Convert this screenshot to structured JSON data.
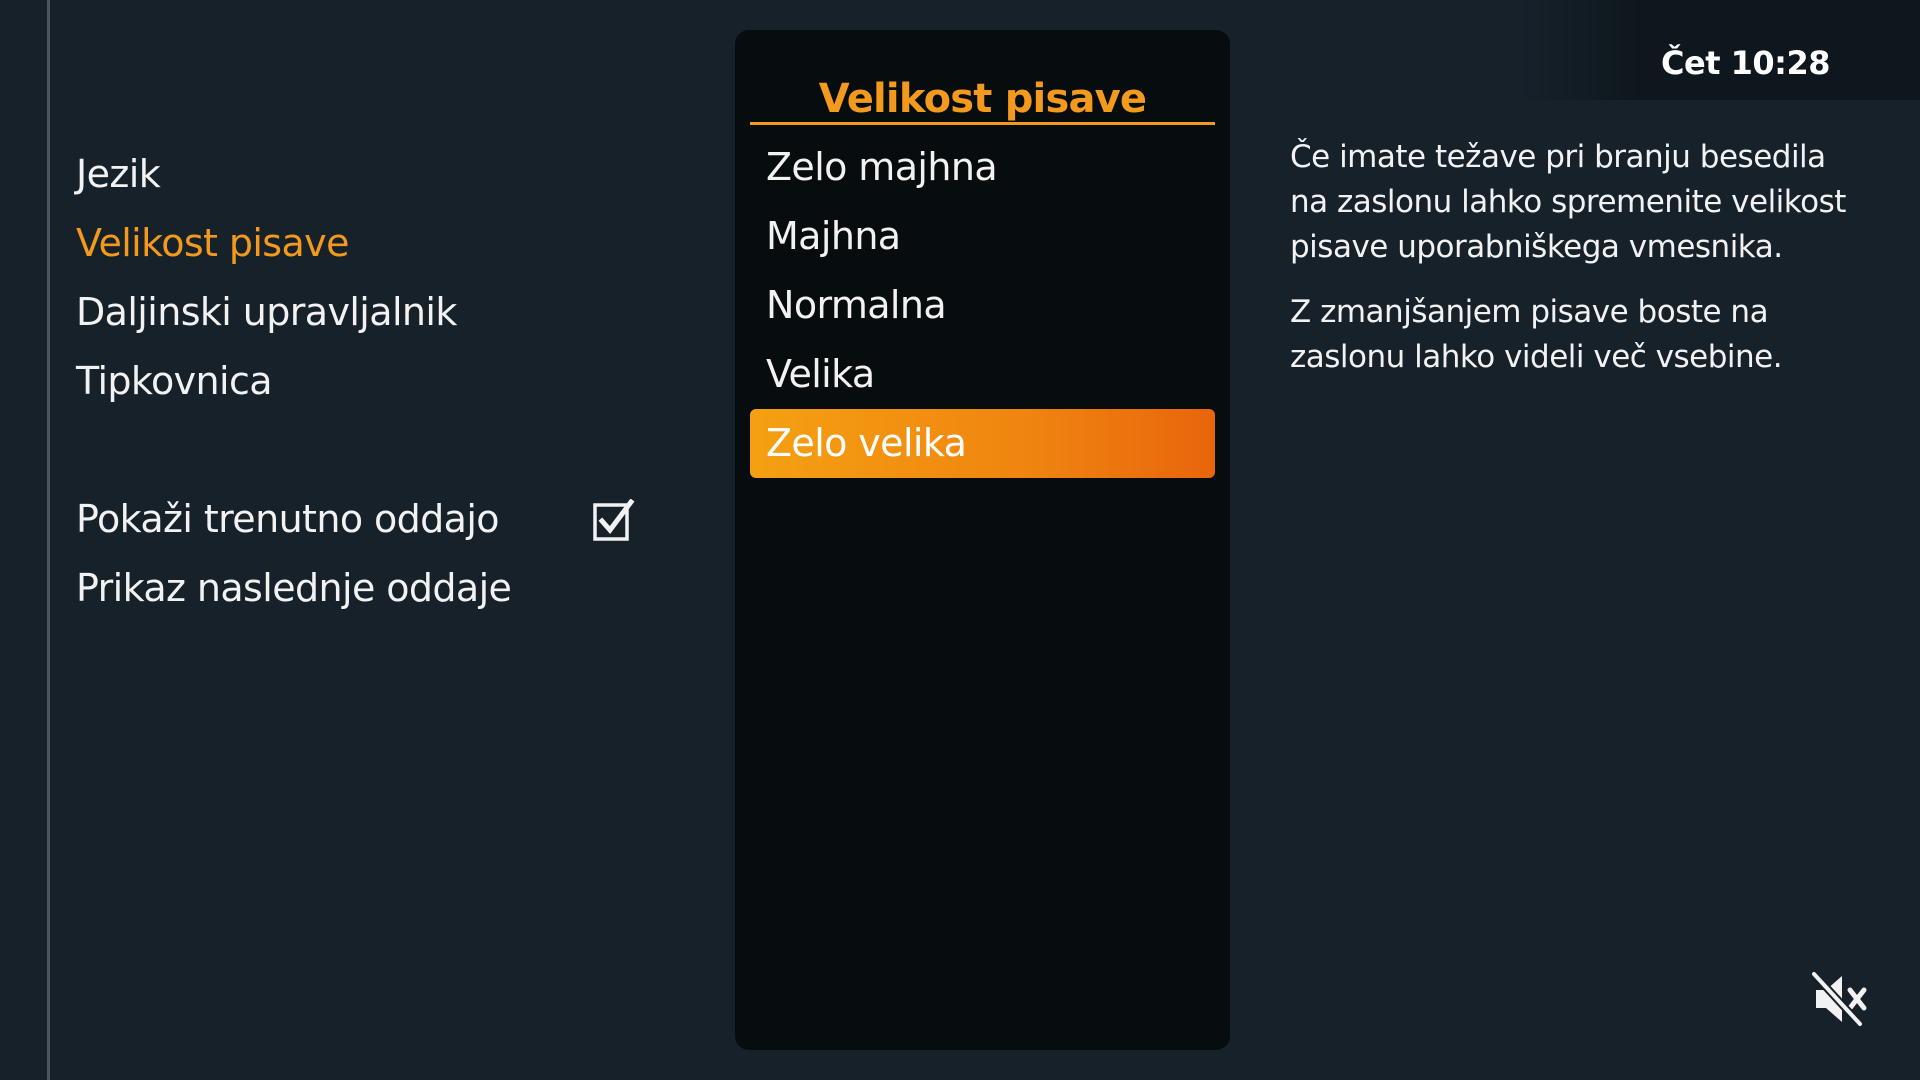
{
  "header": {
    "clock": "Čet 10:28"
  },
  "settings_menu": {
    "items": [
      {
        "label": "Jezik",
        "selected": false
      },
      {
        "label": "Velikost pisave",
        "selected": true
      },
      {
        "label": "Daljinski upravljalnik",
        "selected": false
      },
      {
        "label": "Tipkovnica",
        "selected": false
      }
    ],
    "toggles": [
      {
        "label": "Pokaži trenutno oddajo",
        "checked": true
      },
      {
        "label": "Prikaz naslednje oddaje",
        "checked": false
      }
    ]
  },
  "font_size_panel": {
    "title": "Velikost pisave",
    "options": [
      {
        "label": "Zelo majhna",
        "selected": false
      },
      {
        "label": "Majhna",
        "selected": false
      },
      {
        "label": "Normalna",
        "selected": false
      },
      {
        "label": "Velika",
        "selected": false
      },
      {
        "label": "Zelo velika",
        "selected": true
      }
    ]
  },
  "description": {
    "paragraphs": [
      "Če imate težave pri branju besedila na zaslonu lahko spremenite velikost pisave uporabniškega vmesnika.",
      "Z zmanjšanjem pisave boste na zaslonu lahko videli več vsebine."
    ]
  },
  "icons": {
    "checkbox": "checkbox-checked-icon",
    "mute": "mute-icon"
  },
  "colors": {
    "accent": "#f39a1e",
    "background": "#16212a",
    "panel": "#070c0f"
  }
}
